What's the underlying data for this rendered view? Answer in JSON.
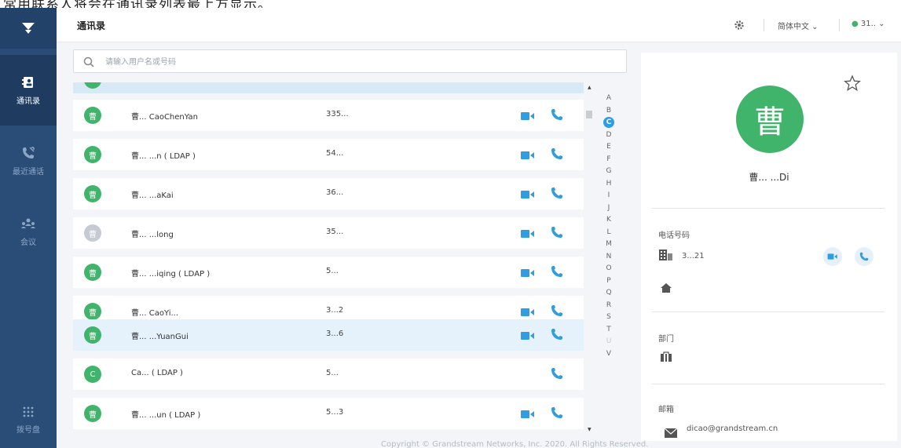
{
  "banner": {
    "text": "常用联系人将会在通讯录列表最上方显示。"
  },
  "app": {
    "header_title": "通讯录",
    "language": "简体中文 ⌄",
    "account": "31.. ⌄"
  },
  "sidebar": {
    "items": [
      {
        "label": "通讯录",
        "icon": "contacts-icon",
        "active": true
      },
      {
        "label": "最近通话",
        "icon": "recent-calls-icon",
        "active": false
      },
      {
        "label": "会议",
        "icon": "meeting-icon",
        "active": false
      },
      {
        "label": "拨号盘",
        "icon": "dialpad-icon",
        "active": false
      }
    ]
  },
  "search": {
    "placeholder": "请输入用户名或号码"
  },
  "contacts": [
    {
      "avatar": "曹",
      "name": "曹... CaoChenYan",
      "number": "335...",
      "selected": false,
      "gray": false
    },
    {
      "avatar": "曹",
      "name": "曹... ...n ( LDAP )",
      "number": "54...",
      "selected": false,
      "gray": false
    },
    {
      "avatar": "曹",
      "name": "曹... ...aKai",
      "number": "36...",
      "selected": false,
      "gray": false
    },
    {
      "avatar": "曹",
      "name": "曹... ...long",
      "number": "35...",
      "selected": false,
      "gray": true
    },
    {
      "avatar": "曹",
      "name": "曹... ...iqing ( LDAP )",
      "number": "5...",
      "selected": false,
      "gray": false
    },
    {
      "avatar": "曹",
      "name": "曹... CaoYi...",
      "number": "3...2",
      "selected": false,
      "gray": false
    },
    {
      "avatar": "曹",
      "name": "曹... ...YuanGui",
      "number": "3...6",
      "selected": true,
      "gray": false
    },
    {
      "avatar": "C",
      "name": "Ca... ( LDAP )",
      "number": "5...",
      "selected": false,
      "gray": false
    },
    {
      "avatar": "曹",
      "name": "曹... ...un ( LDAP )",
      "number": "5...3",
      "selected": false,
      "gray": false
    }
  ],
  "alphabet": {
    "letters": [
      "A",
      "B",
      "C",
      "D",
      "E",
      "F",
      "G",
      "H",
      "I",
      "J",
      "K",
      "L",
      "M",
      "N",
      "O",
      "P",
      "Q",
      "R",
      "S",
      "T",
      "U",
      "V"
    ],
    "active": "C",
    "dim": [
      "U"
    ]
  },
  "detail": {
    "avatar": "曹",
    "name": "曹... ...Di",
    "phone_title": "电话号码",
    "phone_number": "3...21",
    "dept_title": "部门",
    "email_title": "邮箱",
    "email": "dicao@grandstream.cn"
  },
  "footer": {
    "copyright": "Copyright © Grandstream Networks, Inc. 2020. All Rights Reserved."
  },
  "colors": {
    "sidebar": "#2a4d78",
    "accent_green": "#3fb46a",
    "accent_blue": "#2e9ee0",
    "selected_row": "#e5f1fb"
  }
}
